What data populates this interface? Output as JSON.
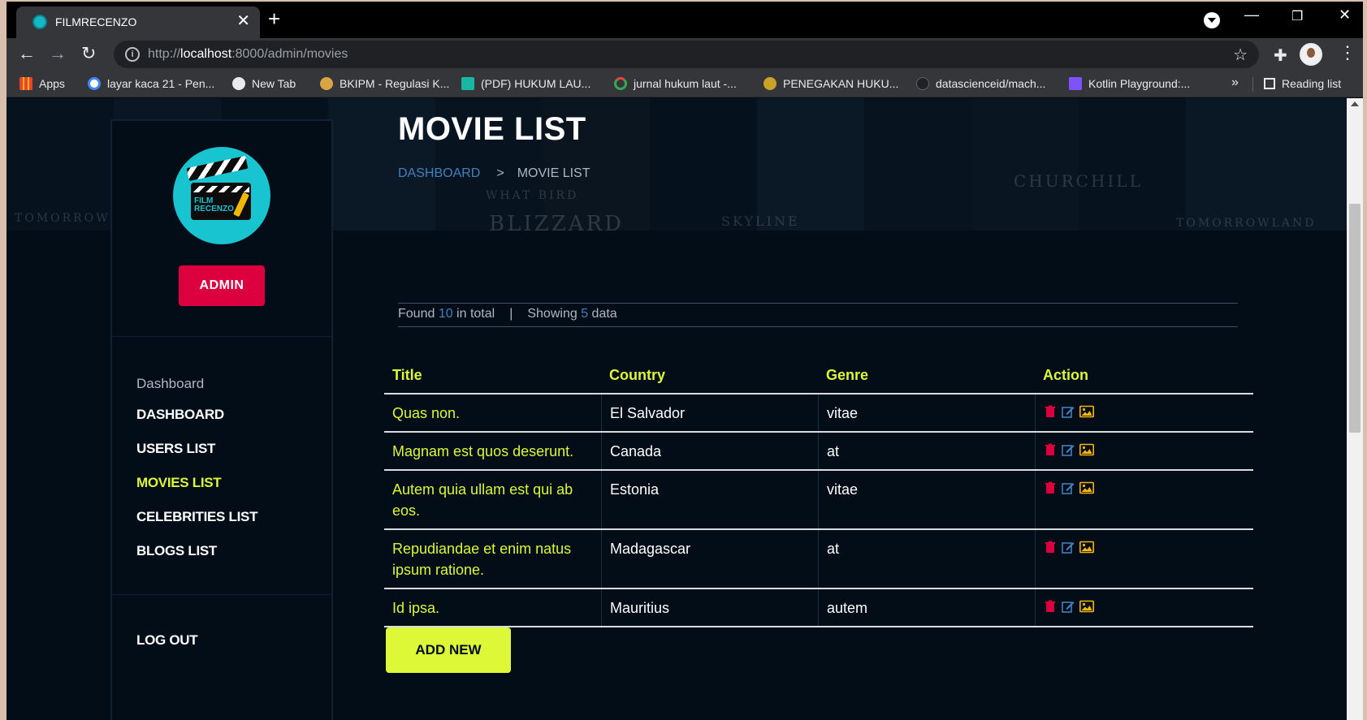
{
  "browser": {
    "tab_title": "FILMRECENZO",
    "tab_close": "✕",
    "new_tab": "+",
    "url_scheme": "http://",
    "url_host": "localhost",
    "url_path": ":8000/admin/movies",
    "bookmarks": [
      {
        "label": "Apps",
        "color": "#4285f4"
      },
      {
        "label": "layar kaca 21 - Pen...",
        "color": "#ffffff"
      },
      {
        "label": "New Tab",
        "color": "#e8eaed"
      },
      {
        "label": "BKIPM - Regulasi K...",
        "color": "#d9a441"
      },
      {
        "label": "(PDF) HUKUM LAU...",
        "color": "#17b6a5"
      },
      {
        "label": "jurnal hukum laut -...",
        "color": "#34a853"
      },
      {
        "label": "PENEGAKAN HUKU...",
        "color": "#c9a227"
      },
      {
        "label": "datascienceid/mach...",
        "color": "#202124"
      },
      {
        "label": "Kotlin Playground:...",
        "color": "#7f52ff"
      }
    ],
    "bookmarks_more": "»",
    "reading_list": "Reading list"
  },
  "hero": {
    "ghost_words": [
      "TOMORROW",
      "WHAT BIRD",
      "BLIZZARD",
      "SKYLINE",
      "CHURCHILL",
      "TOMORROWLAND"
    ]
  },
  "page": {
    "title": "MOVIE LIST",
    "breadcrumb": {
      "link": "DASHBOARD",
      "separator": ">",
      "current": "MOVIE LIST"
    }
  },
  "sidebar": {
    "logo_text": "FILM RECENZO",
    "admin_label": "ADMIN",
    "heading": "Dashboard",
    "items": [
      {
        "label": "DASHBOARD",
        "active": false
      },
      {
        "label": "USERS LIST",
        "active": false
      },
      {
        "label": "MOVIES LIST",
        "active": true
      },
      {
        "label": "CELEBRITIES LIST",
        "active": false
      },
      {
        "label": "BLOGS LIST",
        "active": false
      }
    ],
    "logout": "LOG OUT"
  },
  "summary": {
    "found_prefix": "Found ",
    "found_count": "10",
    "found_suffix": " in total",
    "separator": "|",
    "showing_prefix": "Showing ",
    "showing_count": "5",
    "showing_suffix": " data"
  },
  "table": {
    "headers": [
      "Title",
      "Country",
      "Genre",
      "Action"
    ],
    "rows": [
      {
        "title": "Quas non.",
        "country": "El Salvador",
        "genre": "vitae"
      },
      {
        "title": "Magnam est quos deserunt.",
        "country": "Canada",
        "genre": "at"
      },
      {
        "title": "Autem quia ullam est qui ab eos.",
        "country": "Estonia",
        "genre": "vitae"
      },
      {
        "title": "Repudiandae et enim natus ipsum ratione.",
        "country": "Madagascar",
        "genre": "at"
      },
      {
        "title": "Id ipsa.",
        "country": "Mauritius",
        "genre": "autem"
      }
    ],
    "action_icons": [
      "trash-icon",
      "edit-icon",
      "image-icon"
    ]
  },
  "add_new_label": "ADD NEW",
  "colors": {
    "accent": "#dcf836",
    "danger": "#dd003f",
    "link": "#4280bf",
    "background": "#020d18"
  }
}
